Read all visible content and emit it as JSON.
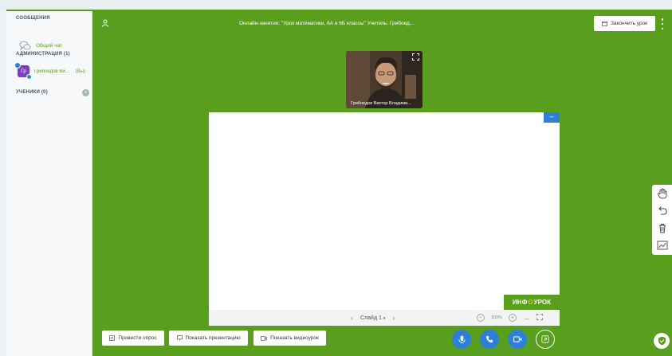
{
  "sidebar": {
    "messages_title": "СООБЩЕНИЯ",
    "general_chat": "Общий чат",
    "admin_title": "АДМИНИСТРАЦИЯ (1)",
    "user_initials": "Гр",
    "user_name": "Грибоедов Ви...",
    "user_you": "(Вы)",
    "students_title": "УЧЕНИКИ (0)"
  },
  "header": {
    "title": "Онлайн-занятие: \"Урок математики, 6А и 6Б классы\" Учитель: Грибоед...",
    "end_button": "Закончить урок"
  },
  "webcam": {
    "label": "Грибоедов Виктор Владими..."
  },
  "slide": {
    "logo_left": "ИНФ",
    "logo_o": "О",
    "logo_right": "УРОК",
    "slide_label": "Слайд 1",
    "zoom": "100%"
  },
  "bottom": {
    "poll_button": "Провести опрос",
    "presentation_button": "Показать презентацию",
    "video_button": "Показать видеоурок"
  },
  "colors": {
    "accent_green": "#5a9e1e",
    "accent_blue": "#2d7fd8",
    "avatar_purple": "#7b3fbf"
  }
}
